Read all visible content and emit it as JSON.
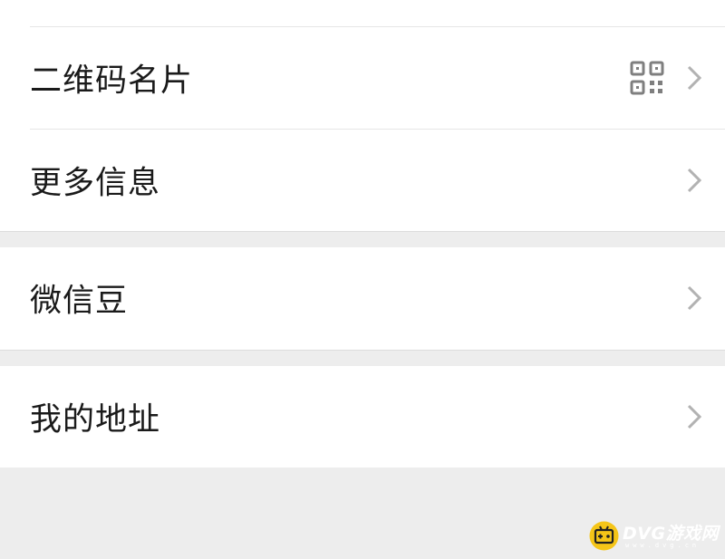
{
  "menu": {
    "items": [
      {
        "label": "二维码名片",
        "icon": "qr-code-icon"
      },
      {
        "label": "更多信息"
      },
      {
        "label": "微信豆"
      },
      {
        "label": "我的地址"
      }
    ]
  },
  "colors": {
    "background": "#ededed",
    "row": "#ffffff",
    "text": "#1a1a1a",
    "chevron": "#b2b2b2",
    "icon": "#7f7f7f",
    "watermark_logo": "#f5c518"
  },
  "watermark": {
    "brand": "DVG游戏网",
    "sub": "www.dvg.cn"
  }
}
